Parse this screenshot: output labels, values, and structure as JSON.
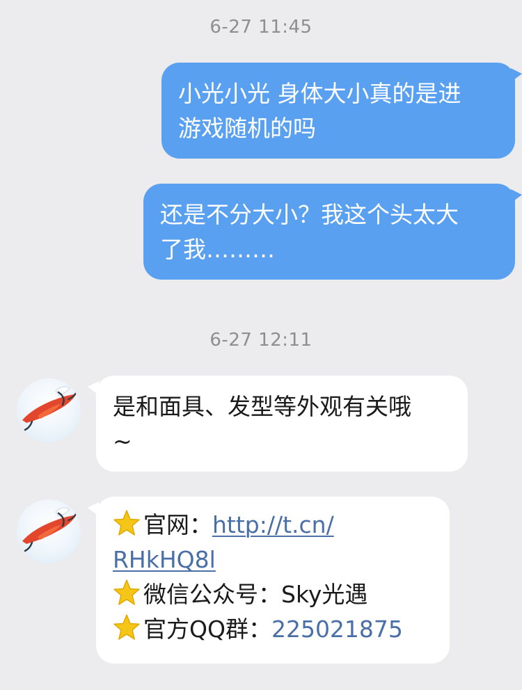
{
  "timestamps": [
    "6-27 11:45",
    "6-27 12:11"
  ],
  "outgoing": [
    {
      "lines": [
        "小光小光 身体大小真的是进",
        "游戏随机的吗"
      ]
    },
    {
      "lines": [
        "还是不分大小？我这个头太大",
        "了我………"
      ]
    }
  ],
  "incoming": [
    {
      "lines": [
        "是和面具、发型等外观有关哦",
        "~"
      ]
    }
  ],
  "info_card": {
    "website_label": "官网：",
    "website_link_part1": "http://t.cn/",
    "website_link_part2": "RHkHQ8l",
    "wechat_label": "微信公众号：",
    "wechat_value": "Sky光遇",
    "qq_label": "官方QQ群：",
    "qq_value": "225021875"
  },
  "icons": {
    "avatar": "sky-game-avatar-icon",
    "star": "star-emoji-icon"
  },
  "colors": {
    "background": "#ececef",
    "outgoing_bubble": "#5aa0f0",
    "incoming_bubble": "#ffffff",
    "link": "#4a6ea8",
    "timestamp": "#8d8d92"
  }
}
